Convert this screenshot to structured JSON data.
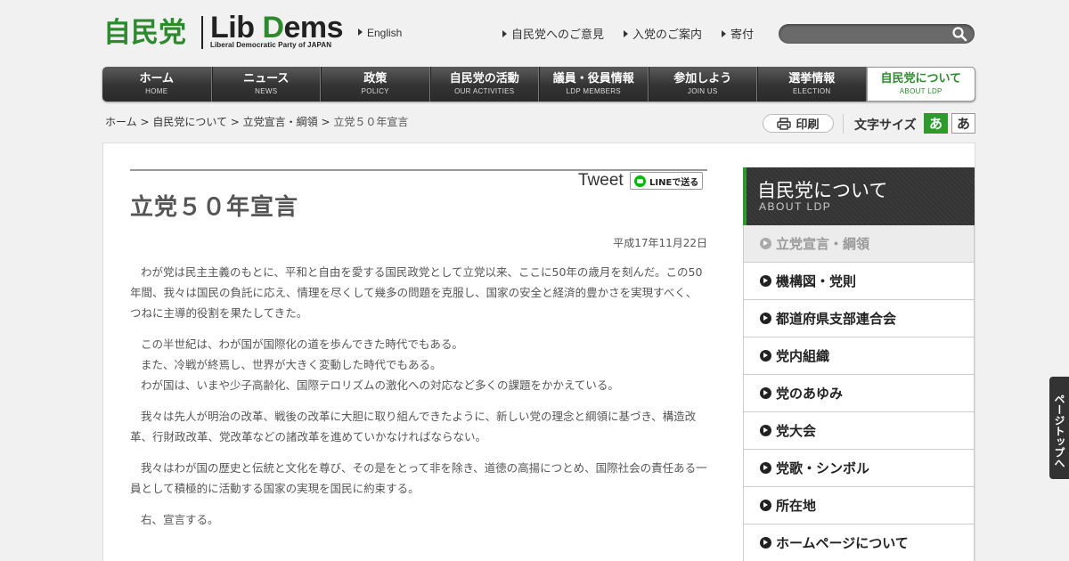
{
  "header": {
    "logo_ja": "自民党",
    "logo_en_a": "Lib ",
    "logo_en_d": "D",
    "logo_en_b": "ems",
    "logo_sub": "Liberal Democratic Party of JAPAN",
    "english_link": "English",
    "links": [
      "自民党へのご意見",
      "入党のご案内",
      "寄付"
    ],
    "search_placeholder": ""
  },
  "nav": {
    "tabs": [
      {
        "ja": "ホーム",
        "en": "HOME"
      },
      {
        "ja": "ニュース",
        "en": "NEWS"
      },
      {
        "ja": "政策",
        "en": "POLICY"
      },
      {
        "ja": "自民党の活動",
        "en": "OUR ACTIVITIES"
      },
      {
        "ja": "議員・役員情報",
        "en": "LDP MEMBERS"
      },
      {
        "ja": "参加しよう",
        "en": "JOIN US"
      },
      {
        "ja": "選挙情報",
        "en": "ELECTION"
      },
      {
        "ja": "自民党について",
        "en": "ABOUT LDP"
      }
    ],
    "active_index": 7
  },
  "breadcrumb": {
    "items": [
      "ホーム",
      "自民党について",
      "立党宣言・綱領"
    ],
    "separator": " > ",
    "current": "立党５０年宣言"
  },
  "tools": {
    "print_label": "印刷",
    "font_size_label": "文字サイズ",
    "font_small": "あ",
    "font_large": "あ"
  },
  "share": {
    "tweet_label": "Tweet",
    "line_label": "LINEで送る"
  },
  "article": {
    "title": "立党５０年宣言",
    "date": "平成17年11月22日",
    "para1": "わが党は民主主義のもとに、平和と自由を愛する国民政党として立党以来、ここに50年の歳月を刻んだ。この50年間、我々は国民の負託に応え、情理を尽くして幾多の問題を克服し、国家の安全と経済的豊かさを実現すべく、つねに主導的役割を果たしてきた。",
    "para2_lines": [
      "この半世紀は、わが国が国際化の道を歩んできた時代でもある。",
      "また、冷戦が終焉し、世界が大きく変動した時代でもある。",
      "わが国は、いまや少子高齢化、国際テロリズムの激化への対応など多くの課題をかかえている。"
    ],
    "para3": "我々は先人が明治の改革、戦後の改革に大胆に取り組んできたように、新しい党の理念と綱領に基づき、構造改革、行財政改革、党改革などの諸改革を進めていかなければならない。",
    "para4": "我々はわが国の歴史と伝統と文化を尊び、その是をとって非を除き、道徳の高揚につとめ、国際社会の責任ある一員として積極的に活動する国家の実現を国民に約束する。",
    "para5": "右、宣言する。"
  },
  "sidebar": {
    "title_ja": "自民党について",
    "title_en": "ABOUT LDP",
    "items": [
      "立党宣言・綱領",
      "機構図・党則",
      "都道府県支部連合会",
      "党内組織",
      "党のあゆみ",
      "党大会",
      "党歌・シンボル",
      "所在地",
      "ホームページについて"
    ],
    "current_index": 0
  },
  "pagetop_label": "ページトップへ",
  "colors": {
    "brand_green": "#2e8a2e",
    "nav_dark": "#333333",
    "font_active": "#2e9a2e"
  }
}
